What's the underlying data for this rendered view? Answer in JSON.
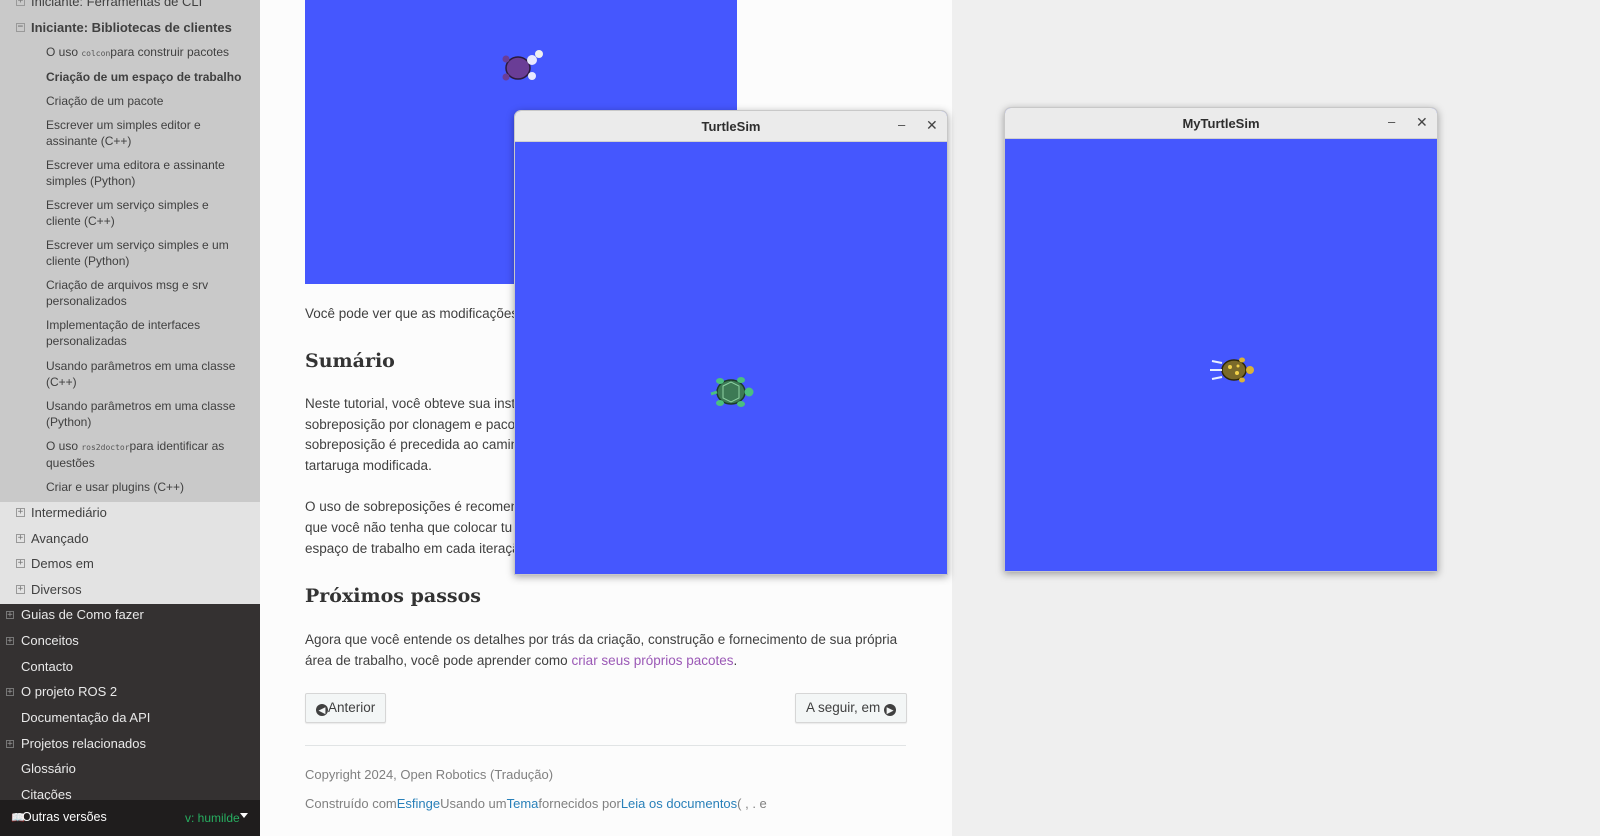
{
  "sidebar": {
    "top_item": "Iniciante: Ferramentas de CLI",
    "current_section": "Iniciante: Bibliotecas de clientes",
    "sub_items": [
      {
        "prefix": "O uso ",
        "code": "colcon",
        "suffix": "para construir pacotes"
      },
      {
        "label": "Criação de um espaço de trabalho"
      },
      {
        "label": "Criação de um pacote"
      },
      {
        "label": "Escrever um simples editor e assinante (C++)"
      },
      {
        "label": "Escrever uma editora e assinante simples (Python)"
      },
      {
        "label": "Escrever um serviço simples e cliente (C++)"
      },
      {
        "label": "Escrever um serviço simples e um cliente (Python)"
      },
      {
        "label": "Criação de arquivos msg e srv personalizados"
      },
      {
        "label": "Implementação de interfaces personalizadas"
      },
      {
        "label": "Usando parâmetros em uma classe (C++)"
      },
      {
        "label": "Usando parâmetros em uma classe (Python)"
      },
      {
        "prefix": "O uso ",
        "code": "ros2doctor",
        "suffix": "para identificar as questões"
      },
      {
        "label": "Criar e usar plugins (C++)"
      }
    ],
    "level2_items": [
      "Intermediário",
      "Avançado",
      "Demos em",
      "Diversos"
    ],
    "level1_items": [
      "Guias de Como fazer",
      "Conceitos",
      "Contacto",
      "O projeto ROS 2",
      "Documentação da API",
      "Projetos relacionados",
      "Glossário",
      "Citações"
    ],
    "versions_label": "Outras versões",
    "version_value": "v: humilde"
  },
  "content": {
    "partial_line": "Você pode ver que as modificações",
    "summary_heading": "Sumário",
    "summary_p1": [
      "Neste tutorial, você obteve sua inst",
      "sobreposição por clonagem e paco",
      "sobreposição é precedida ao camin",
      "tartaruga modificada."
    ],
    "summary_p2": [
      "O uso de sobreposições é recomen",
      "que você não tenha que colocar tu",
      "espaço de trabalho em cada iteraçã"
    ],
    "next_heading": "Próximos passos",
    "next_p_line1": "Agora que você entende os detalhes por trás da criação, construção e fornecimento de sua própria",
    "next_p_line2_prefix": "área de trabalho, você pode aprender como ",
    "next_p_link": "criar seus próprios pacotes",
    "next_p_suffix": ".",
    "prev_button": "Anterior",
    "next_button": "A seguir, em",
    "copyright": "Copyright 2024, Open Robotics (Tradução)",
    "built_with": [
      "Construído com",
      "Esfinge",
      "Usando um",
      "Tema",
      "fornecidos por",
      "Leia os documentos",
      "( , . e"
    ]
  },
  "windows": {
    "turtlesim_title": "TurtleSim",
    "myturtlesim_title": "MyTurtleSim",
    "minimize_glyph": "–",
    "close_glyph": "✕",
    "canvas_color": "#4557fe"
  }
}
